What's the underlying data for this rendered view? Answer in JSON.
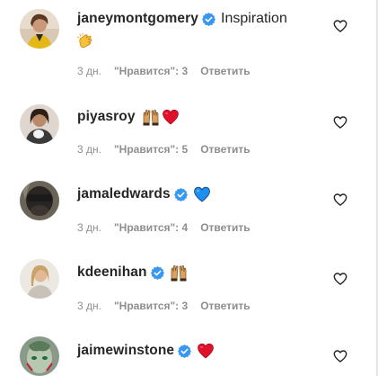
{
  "comments": [
    {
      "username": "janeymontgomery",
      "text": "Inspiration",
      "emojis": [
        "clapping-hands"
      ],
      "time": "3 дн.",
      "likes": "\"Нравится\": 3",
      "reply": "Ответить"
    },
    {
      "username": "piyasroy",
      "text": "",
      "emojis": [
        "raising-hands",
        "red-heart"
      ],
      "time": "3 дн.",
      "likes": "\"Нравится\": 5",
      "reply": "Ответить"
    },
    {
      "username": "jamaledwards",
      "text": "",
      "emojis": [
        "blue-heart"
      ],
      "time": "3 дн.",
      "likes": "\"Нравится\": 4",
      "reply": "Ответить"
    },
    {
      "username": "kdeenihan",
      "text": "",
      "emojis": [
        "raising-hands"
      ],
      "time": "3 дн.",
      "likes": "\"Нравится\": 3",
      "reply": "Ответить"
    },
    {
      "username": "jaimewinstone",
      "text": "",
      "emojis": [
        "red-heart"
      ],
      "time": "",
      "likes": "",
      "reply": ""
    }
  ],
  "colors": {
    "verified_blue": "#3897f0",
    "text": "#262626",
    "meta_gray": "#8e8e8e"
  }
}
